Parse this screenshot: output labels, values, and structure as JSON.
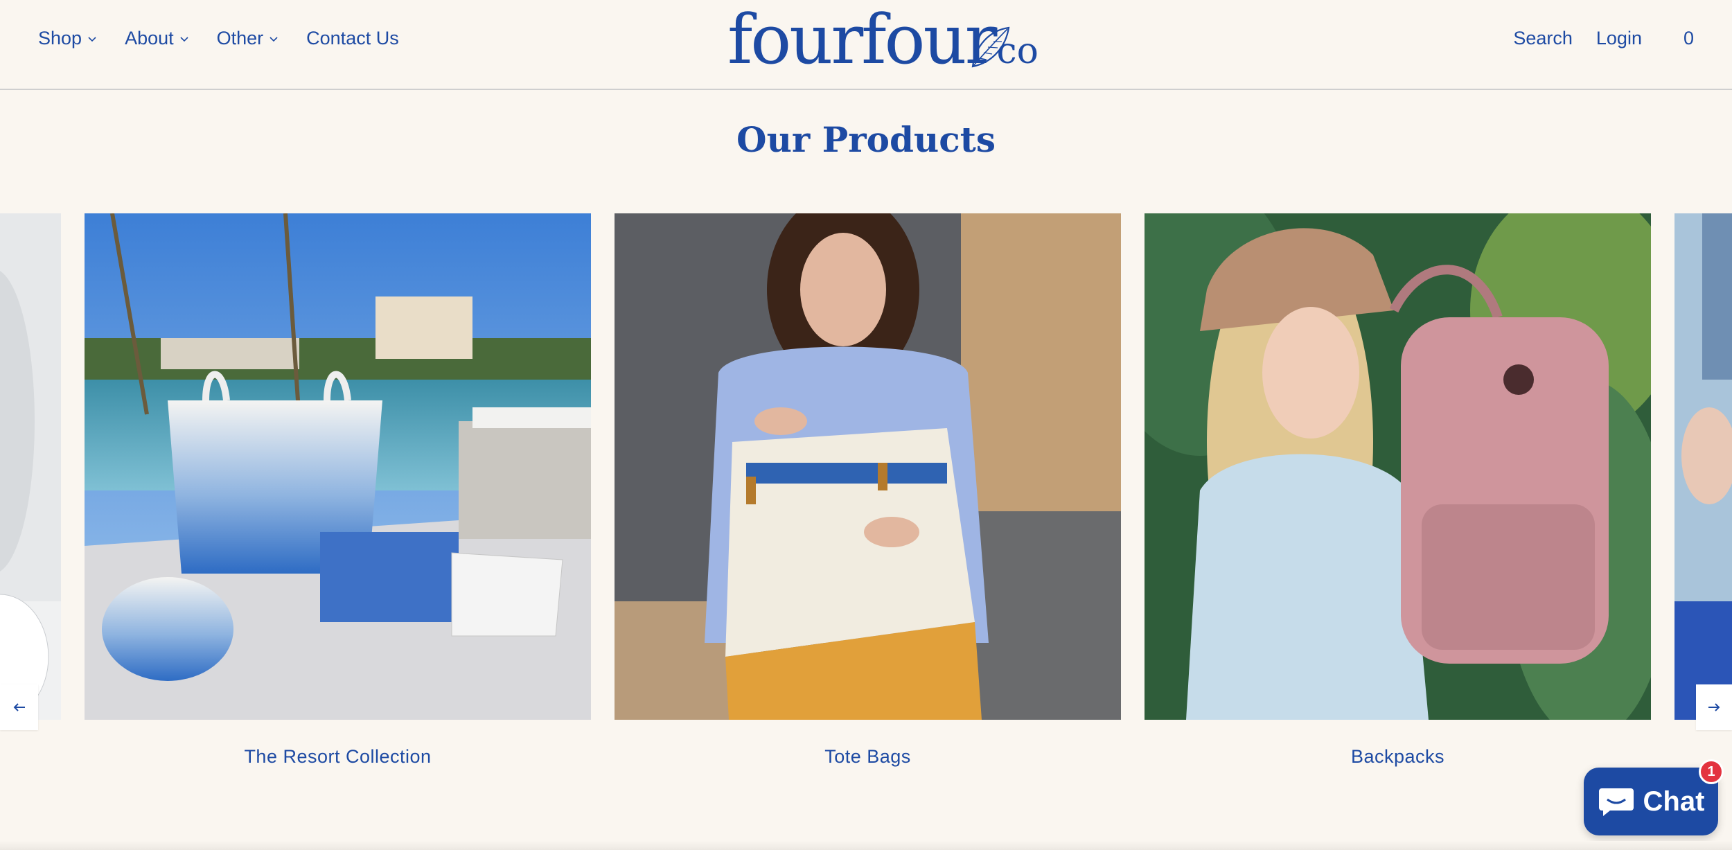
{
  "header": {
    "nav_left": [
      {
        "label": "Shop",
        "has_dropdown": true
      },
      {
        "label": "About",
        "has_dropdown": true
      },
      {
        "label": "Other",
        "has_dropdown": true
      },
      {
        "label": "Contact Us",
        "has_dropdown": false
      }
    ],
    "logo": {
      "main": "fourfour",
      "suffix": "co"
    },
    "nav_right": {
      "search": "Search",
      "login": "Login",
      "cart_count": "0"
    }
  },
  "section": {
    "title": "Our Products"
  },
  "carousel": {
    "items": [
      {
        "label": "The Resort Collection"
      },
      {
        "label": "Tote Bags"
      },
      {
        "label": "Backpacks"
      }
    ],
    "prev_icon": "arrow-left-icon",
    "next_icon": "arrow-right-icon"
  },
  "chat": {
    "label": "Chat",
    "badge": "1"
  },
  "colors": {
    "brand": "#1d4aa3",
    "background": "#faf6f0",
    "badge": "#e3333f"
  }
}
